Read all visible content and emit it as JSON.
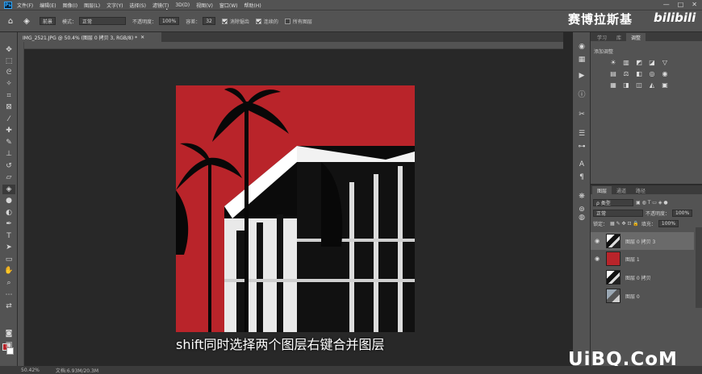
{
  "menubar": {
    "logo": "Ps",
    "items": [
      "文件(F)",
      "编辑(E)",
      "图像(I)",
      "图层(L)",
      "文字(Y)",
      "选择(S)",
      "滤镜(T)",
      "3D(D)",
      "视图(V)",
      "窗口(W)",
      "帮助(H)"
    ],
    "window_controls": [
      "—",
      "□",
      "✕"
    ]
  },
  "options": {
    "tool_icon": "paint-bucket-icon",
    "fill_source": "前景",
    "mode_label": "模式：",
    "mode_value": "正常",
    "opacity_label": "不透明度：",
    "opacity_value": "100%",
    "tolerance_label": "容差：",
    "tolerance_value": "32",
    "antialias_label": "消除锯齿",
    "contiguous_label": "连续的",
    "all_layers_label": "所有图层"
  },
  "watermark": {
    "author": "赛博拉斯基",
    "bilibili": "bilibili",
    "site": "UiBQ.CoM"
  },
  "document": {
    "tab_title": "IMG_2521.JPG @ 50.4% (图层 0 拷贝 3, RGB/8) *",
    "tab_close": "✕"
  },
  "caption": "shift同时选择两个图层右键合并图层",
  "status": {
    "zoom": "50.42%",
    "doc_info": "文档:6.93M/20.3M"
  },
  "tools": [
    "move-icon",
    "marquee-icon",
    "lasso-icon",
    "magic-wand-icon",
    "crop-icon",
    "frame-icon",
    "eyedropper-icon",
    "healing-icon",
    "brush-icon",
    "clone-stamp-icon",
    "history-brush-icon",
    "eraser-icon",
    "paint-bucket-icon",
    "blur-icon",
    "dodge-icon",
    "pen-icon",
    "type-icon",
    "path-select-icon",
    "rectangle-icon",
    "hand-icon",
    "zoom-icon",
    "more-tools-icon"
  ],
  "panels": {
    "top_tabs": [
      "学习",
      "库",
      "调整"
    ],
    "active_top_tab": "调整",
    "adjust_title": "添加调整",
    "layers_tabs": [
      "图层",
      "通道",
      "路径"
    ],
    "kind_label": "ρ 类型",
    "blend_mode": "正常",
    "opacity_label": "不透明度：",
    "opacity_value": "100%",
    "lock_label": "锁定：",
    "fill_label": "填充：",
    "fill_value": "100%",
    "layers": [
      {
        "name": "图层 0 拷贝 3",
        "visible": true,
        "selected": true,
        "thumb": "bw"
      },
      {
        "name": "图层 1",
        "visible": true,
        "selected": false,
        "thumb": "red"
      },
      {
        "name": "图层 0 拷贝",
        "visible": false,
        "selected": false,
        "thumb": "bw"
      },
      {
        "name": "图层 0",
        "visible": false,
        "selected": false,
        "thumb": "photo"
      }
    ]
  },
  "colors": {
    "artboard_red": "#b9242a",
    "ui_gray": "#535353",
    "canvas_bg": "#282828"
  }
}
